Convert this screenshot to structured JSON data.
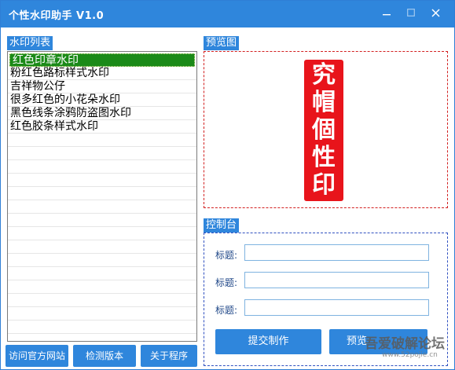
{
  "window": {
    "title": "个性水印助手 V1.0",
    "controls": [
      "minimize-icon",
      "maximize-icon",
      "close-icon"
    ]
  },
  "list_panel": {
    "label": "水印列表",
    "items": [
      {
        "label": "红色印章水印",
        "selected": true
      },
      {
        "label": "粉红色路标样式水印",
        "selected": false
      },
      {
        "label": "吉祥物公仔",
        "selected": false
      },
      {
        "label": "很多红色的小花朵水印",
        "selected": false
      },
      {
        "label": "黑色线条涂鸦防盗图水印",
        "selected": false
      },
      {
        "label": "红色胶条样式水印",
        "selected": false
      }
    ]
  },
  "preview_panel": {
    "label": "预览图",
    "stamp_text": [
      "究",
      "帽",
      "個",
      "性",
      "印"
    ],
    "stamp_color": "#e8141b"
  },
  "control_panel": {
    "label": "控制台",
    "fields": [
      {
        "label": "标题:",
        "value": "",
        "placeholder": ""
      },
      {
        "label": "标题:",
        "value": "",
        "placeholder": ""
      },
      {
        "label": "标题:",
        "value": "",
        "placeholder": ""
      }
    ],
    "submit_label": "提交制作",
    "preview_label": "预览"
  },
  "bottom_buttons": {
    "visit_site": "访问官方网站",
    "check_version": "检测版本",
    "about": "关于程序"
  },
  "overlay": {
    "text": "吾爱破解论坛",
    "subtext": "www.52pojie.cn"
  },
  "colors": {
    "accent": "#2f86dc",
    "selection": "#1b8a18",
    "preview_border": "#d22020",
    "control_border": "#3050c0"
  }
}
